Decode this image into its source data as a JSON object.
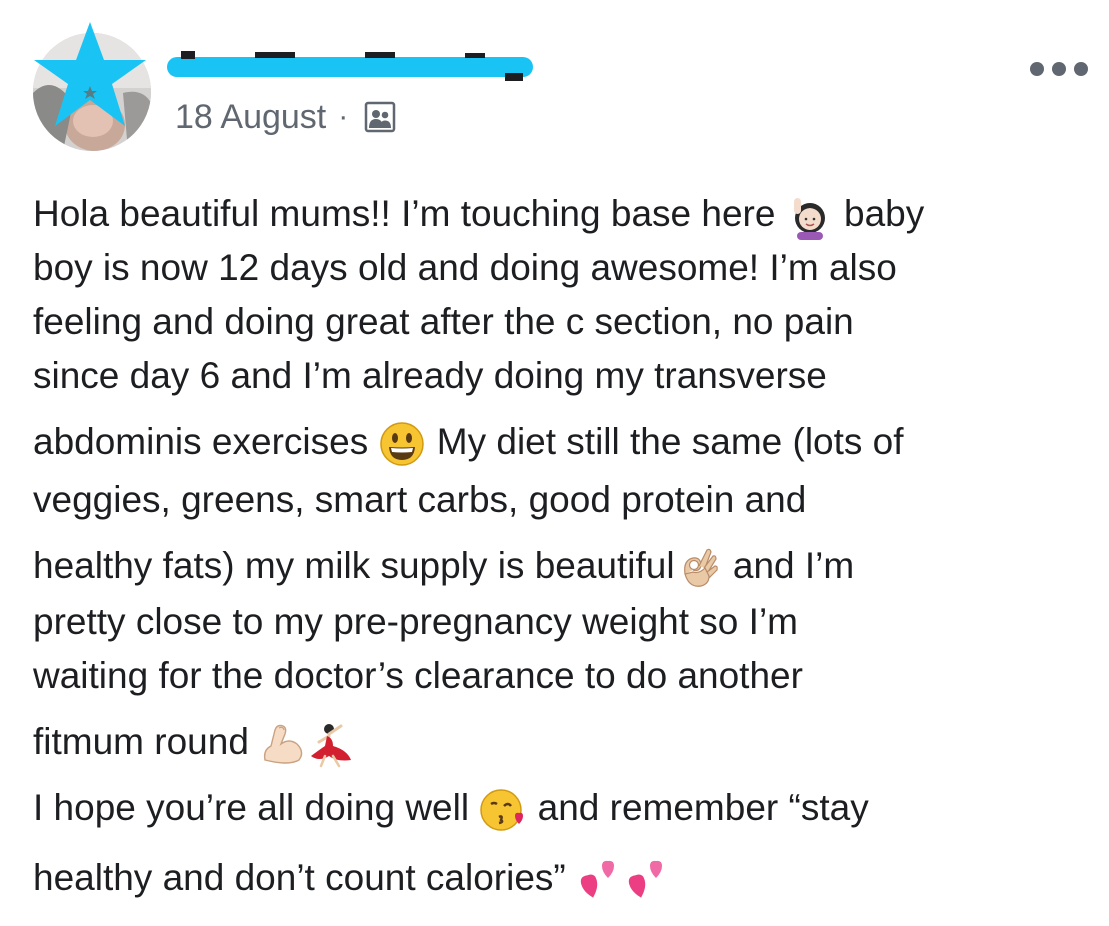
{
  "post": {
    "date": "18 August",
    "separator": "·",
    "audience_icon": "group-audience-icon",
    "more_icon": "more-options-icon",
    "lines": [
      {
        "segments": [
          {
            "t": "Hola beautiful mums!! I’m touching base here "
          },
          {
            "e": "woman-raising-hand-emoji"
          },
          {
            "t": " baby"
          }
        ]
      },
      {
        "segments": [
          {
            "t": "boy is now 12 days old and doing awesome! I’m also"
          }
        ]
      },
      {
        "segments": [
          {
            "t": "feeling and doing great after the c section, no pain"
          }
        ]
      },
      {
        "segments": [
          {
            "t": "since day 6 and I’m already doing my transverse"
          }
        ]
      },
      {
        "segments": [
          {
            "t": "abdominis exercises "
          },
          {
            "e": "grinning-face-emoji"
          },
          {
            "t": " My diet still the same (lots of"
          }
        ]
      },
      {
        "segments": [
          {
            "t": "veggies, greens, smart carbs, good protein and"
          }
        ]
      },
      {
        "segments": [
          {
            "t": "healthy fats) my milk supply is beautiful"
          },
          {
            "e": "ok-hand-emoji"
          },
          {
            "t": " and I’m"
          }
        ]
      },
      {
        "segments": [
          {
            "t": "pretty close to my pre-pregnancy weight so I’m"
          }
        ]
      },
      {
        "segments": [
          {
            "t": "waiting for the doctor’s clearance to do another"
          }
        ]
      },
      {
        "segments": [
          {
            "t": "fitmum round "
          },
          {
            "e": "flexed-biceps-emoji"
          },
          {
            "e": "dancer-emoji"
          }
        ]
      },
      {
        "segments": [
          {
            "t": "I hope you’re all doing well "
          },
          {
            "e": "kissing-face-emoji"
          },
          {
            "t": " and remember “stay"
          }
        ]
      },
      {
        "segments": [
          {
            "t": "healthy and don’t count calories” "
          },
          {
            "e": "two-hearts-emoji"
          },
          {
            "e": "two-hearts-emoji"
          }
        ]
      }
    ]
  },
  "colors": {
    "text": "#1c1e21",
    "meta": "#606770",
    "redact": "#19c4f5"
  }
}
